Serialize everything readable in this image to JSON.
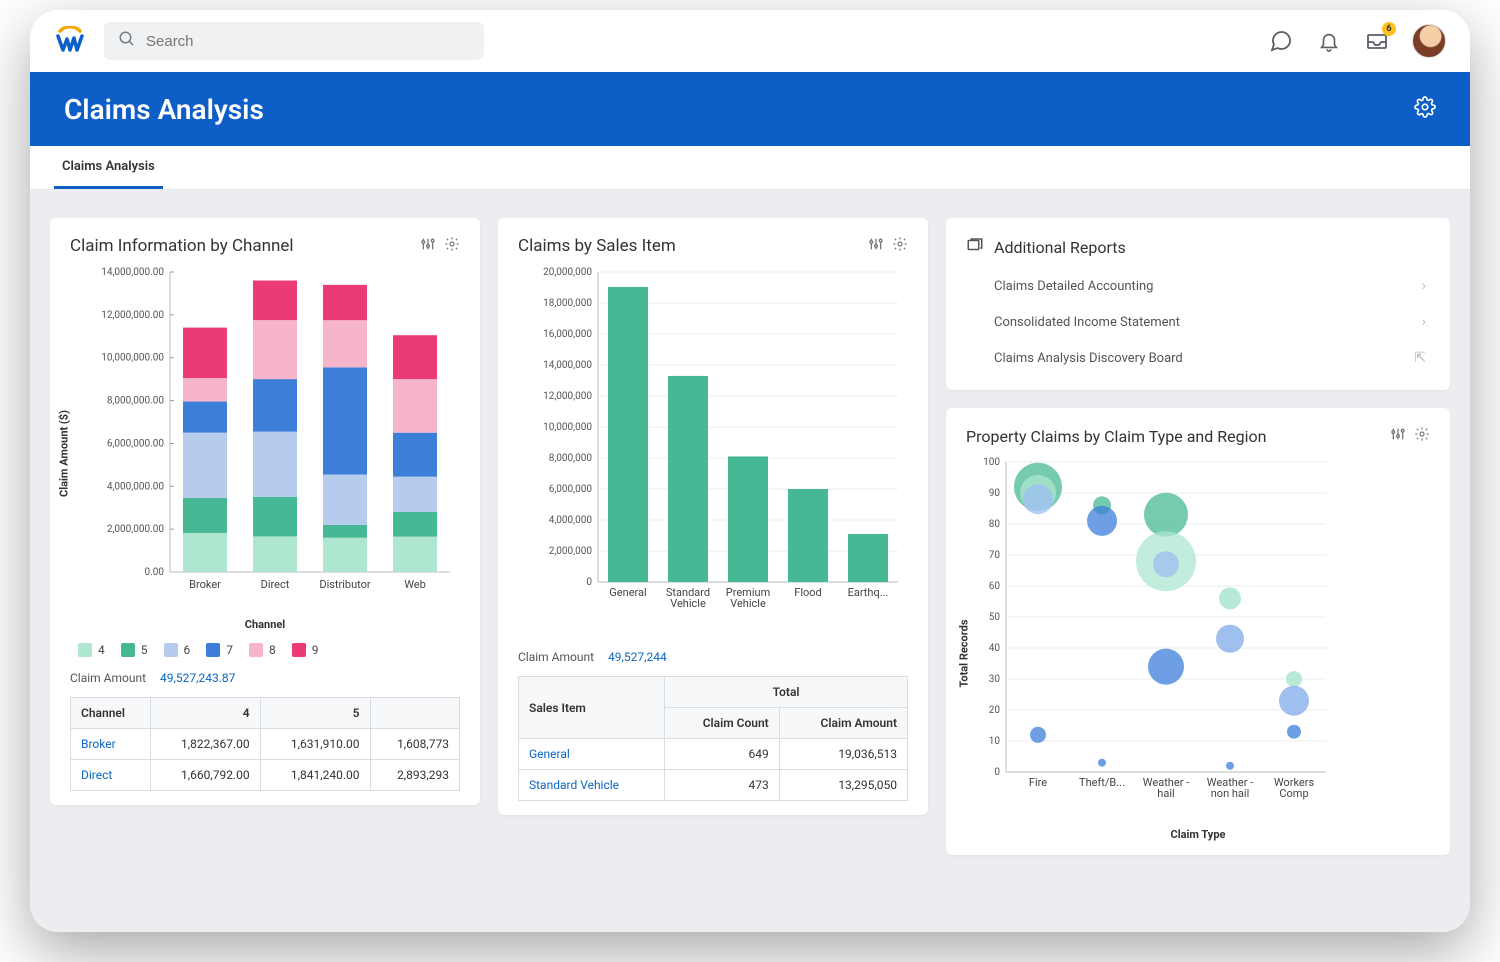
{
  "search_placeholder": "Search",
  "inbox_badge": "6",
  "page_title": "Claims Analysis",
  "tab_active": "Claims Analysis",
  "chart1": {
    "title": "Claim Information by Channel",
    "xlabel": "Channel",
    "ylabel": "Claim Amount ($)",
    "sum_label": "Claim Amount",
    "sum_value": "49,527,243.87",
    "legend": [
      "4",
      "5",
      "6",
      "7",
      "8",
      "9"
    ],
    "colors": {
      "4": "#aee6cf",
      "5": "#47b895",
      "6": "#b7cbec",
      "7": "#3d7ed9",
      "8": "#f7b5cc",
      "9": "#ec3a78"
    },
    "table_cols": [
      "Channel",
      "4",
      "5"
    ],
    "table_rows": [
      {
        "channel": "Broker",
        "c4": "1,822,367.00",
        "c5": "1,631,910.00",
        "c6": "1,608,773"
      },
      {
        "channel": "Direct",
        "c4": "1,660,792.00",
        "c5": "1,841,240.00",
        "c6": "2,893,293"
      }
    ]
  },
  "chart_data": [
    {
      "id": "claim_info_by_channel",
      "type": "bar-stacked",
      "title": "Claim Information by Channel",
      "xlabel": "Channel",
      "ylabel": "Claim Amount ($)",
      "categories": [
        "Broker",
        "Direct",
        "Distributor",
        "Web"
      ],
      "yticks": [
        0,
        2000000,
        4000000,
        6000000,
        8000000,
        10000000,
        12000000,
        14000000
      ],
      "ytick_labels": [
        "0.00",
        "2,000,000.00",
        "4,000,000.00",
        "6,000,000.00",
        "8,000,000.00",
        "10,000,000.00",
        "12,000,000.00",
        "14,000,000.00"
      ],
      "ylim": [
        0,
        14000000
      ],
      "series": [
        {
          "name": "4",
          "color": "#aee6cf",
          "values": [
            1822367,
            1660792,
            1600000,
            1650000
          ]
        },
        {
          "name": "5",
          "color": "#47b895",
          "values": [
            1631910,
            1841240,
            600000,
            1150000
          ]
        },
        {
          "name": "6",
          "color": "#b7cbec",
          "values": [
            3050000,
            3050000,
            2350000,
            1650000
          ]
        },
        {
          "name": "7",
          "color": "#3d7ed9",
          "values": [
            1450000,
            2450000,
            5000000,
            2050000
          ]
        },
        {
          "name": "8",
          "color": "#f7b5cc",
          "values": [
            1100000,
            2750000,
            2200000,
            2500000
          ]
        },
        {
          "name": "9",
          "color": "#ec3a78",
          "values": [
            2350000,
            1850000,
            1650000,
            2050000
          ]
        }
      ]
    },
    {
      "id": "claims_by_sales_item",
      "type": "bar",
      "title": "Claims by Sales Item",
      "categories": [
        "General",
        "Standard Vehicle",
        "Premium Vehicle",
        "Flood",
        "Earthq..."
      ],
      "yticks": [
        0,
        2000000,
        4000000,
        6000000,
        8000000,
        10000000,
        12000000,
        14000000,
        16000000,
        18000000,
        20000000
      ],
      "ytick_labels": [
        "0",
        "2,000,000",
        "4,000,000",
        "6,000,000",
        "8,000,000",
        "10,000,000",
        "12,000,000",
        "14,000,000",
        "16,000,000",
        "18,000,000",
        "20,000,000"
      ],
      "ylim": [
        0,
        20000000
      ],
      "values": [
        19036513,
        13295050,
        8100000,
        6000000,
        3100000
      ],
      "color": "#47b895"
    },
    {
      "id": "property_claims_by_type_region",
      "type": "bubble",
      "title": "Property Claims by Claim Type and Region",
      "xlabel": "Claim Type",
      "ylabel": "Total Records",
      "x_categories": [
        "Fire",
        "Theft/B...",
        "Weather - hail",
        "Weather - non hail",
        "Workers Comp"
      ],
      "ylim": [
        0,
        100
      ],
      "yticks": [
        0,
        10,
        20,
        30,
        40,
        50,
        60,
        70,
        80,
        90,
        100
      ],
      "points": [
        {
          "x": "Fire",
          "y": 92,
          "r": 24,
          "color": "#47b895"
        },
        {
          "x": "Fire",
          "y": 90,
          "r": 18,
          "color": "#aee6cf"
        },
        {
          "x": "Fire",
          "y": 88,
          "r": 15,
          "color": "#9dbff2"
        },
        {
          "x": "Fire",
          "y": 12,
          "r": 8,
          "color": "#3d7ed9"
        },
        {
          "x": "Theft/B...",
          "y": 86,
          "r": 9,
          "color": "#47b895"
        },
        {
          "x": "Theft/B...",
          "y": 81,
          "r": 15,
          "color": "#3d7ed9"
        },
        {
          "x": "Theft/B...",
          "y": 3,
          "r": 4,
          "color": "#3d7ed9"
        },
        {
          "x": "Weather - hail",
          "y": 83,
          "r": 22,
          "color": "#47b895"
        },
        {
          "x": "Weather - hail",
          "y": 68,
          "r": 30,
          "color": "#aee6cf"
        },
        {
          "x": "Weather - hail",
          "y": 67,
          "r": 13,
          "color": "#9dbff2"
        },
        {
          "x": "Weather - hail",
          "y": 34,
          "r": 18,
          "color": "#3d7ed9"
        },
        {
          "x": "Weather - non hail",
          "y": 56,
          "r": 11,
          "color": "#9fe1c8"
        },
        {
          "x": "Weather - non hail",
          "y": 43,
          "r": 14,
          "color": "#7fa9e8"
        },
        {
          "x": "Weather - non hail",
          "y": 2,
          "r": 4,
          "color": "#3d7ed9"
        },
        {
          "x": "Workers Comp",
          "y": 30,
          "r": 8,
          "color": "#9fe1c8"
        },
        {
          "x": "Workers Comp",
          "y": 23,
          "r": 15,
          "color": "#7fa9e8"
        },
        {
          "x": "Workers Comp",
          "y": 13,
          "r": 7,
          "color": "#3d7ed9"
        }
      ]
    }
  ],
  "chart2": {
    "title": "Claims by Sales Item",
    "sum_label": "Claim Amount",
    "sum_value": "49,527,244",
    "table_head1": "Sales Item",
    "table_head_total": "Total",
    "table_head2": "Claim Count",
    "table_head3": "Claim Amount",
    "rows": [
      {
        "name": "General",
        "count": "649",
        "amount": "19,036,513"
      },
      {
        "name": "Standard Vehicle",
        "count": "473",
        "amount": "13,295,050"
      }
    ]
  },
  "reports": {
    "title": "Additional Reports",
    "items": [
      "Claims Detailed Accounting",
      "Consolidated Income Statement",
      "Claims Analysis Discovery Board"
    ]
  },
  "chart3": {
    "title": "Property Claims by Claim Type and Region",
    "xlabel": "Claim Type",
    "ylabel": "Total Records"
  }
}
